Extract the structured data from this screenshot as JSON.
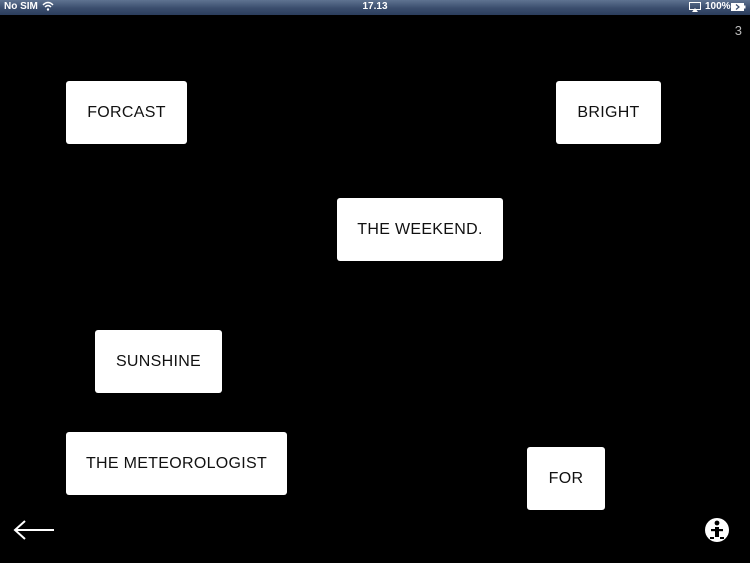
{
  "status_bar": {
    "carrier": "No SIM",
    "time": "17.13",
    "battery_percent": "100%",
    "icons": [
      "wifi-icon",
      "airplay-icon",
      "battery-icon"
    ]
  },
  "page": {
    "number": "3"
  },
  "cards": [
    {
      "word": "FORCAST"
    },
    {
      "word": "BRIGHT"
    },
    {
      "word": "THE WEEKEND."
    },
    {
      "word": "SUNSHINE"
    },
    {
      "word": "THE METEOROLOGIST"
    },
    {
      "word": "FOR"
    }
  ],
  "controls": {
    "back_icon": "left-arrow-icon",
    "info_icon": "accessibility-info-icon"
  },
  "colors": {
    "background": "#000000",
    "card": "#ffffff",
    "card_text": "#111111",
    "status_bar": "#3a4d6d"
  }
}
